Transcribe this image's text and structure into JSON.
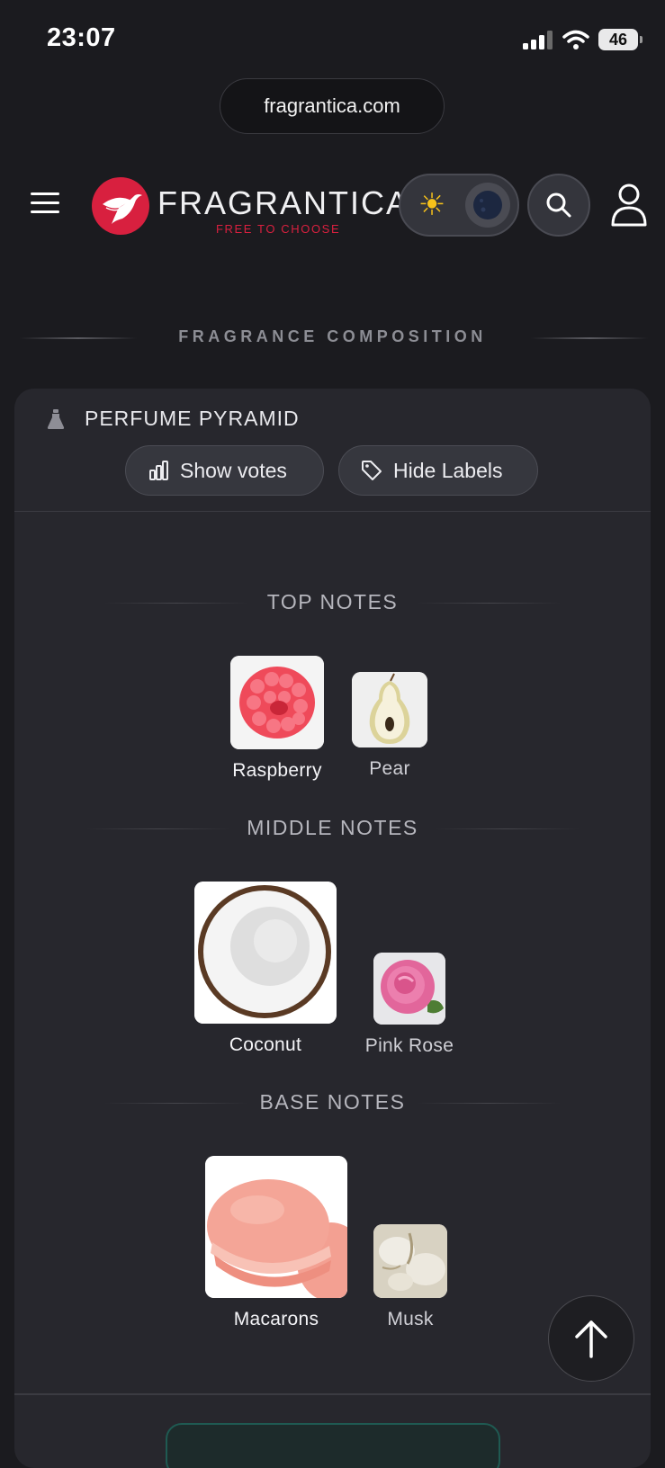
{
  "status_bar": {
    "time": "23:07",
    "battery": "46"
  },
  "browser": {
    "url": "fragrantica.com"
  },
  "header": {
    "brand": "FRAGRANTICA",
    "tagline": "FREE TO CHOOSE"
  },
  "section": {
    "title": "FRAGRANCE COMPOSITION"
  },
  "pyramid": {
    "title": "PERFUME PYRAMID",
    "show_votes_label": "Show votes",
    "hide_labels_label": "Hide Labels",
    "tiers": [
      {
        "title": "TOP NOTES",
        "notes": [
          {
            "name": "Raspberry"
          },
          {
            "name": "Pear"
          }
        ]
      },
      {
        "title": "MIDDLE NOTES",
        "notes": [
          {
            "name": "Coconut"
          },
          {
            "name": "Pink Rose"
          }
        ]
      },
      {
        "title": "BASE NOTES",
        "notes": [
          {
            "name": "Macarons"
          },
          {
            "name": "Musk"
          }
        ]
      }
    ]
  },
  "icons": {
    "menu": "hamburger-menu-icon",
    "theme_light": "sun-icon",
    "theme_dark": "moon-icon",
    "search": "search-icon",
    "user": "user-icon",
    "scroll_top": "arrow-up-icon"
  },
  "colors": {
    "background": "#1b1b1f",
    "card": "#27272d",
    "brand_red": "#d8203f",
    "sun": "#f7c21a"
  }
}
